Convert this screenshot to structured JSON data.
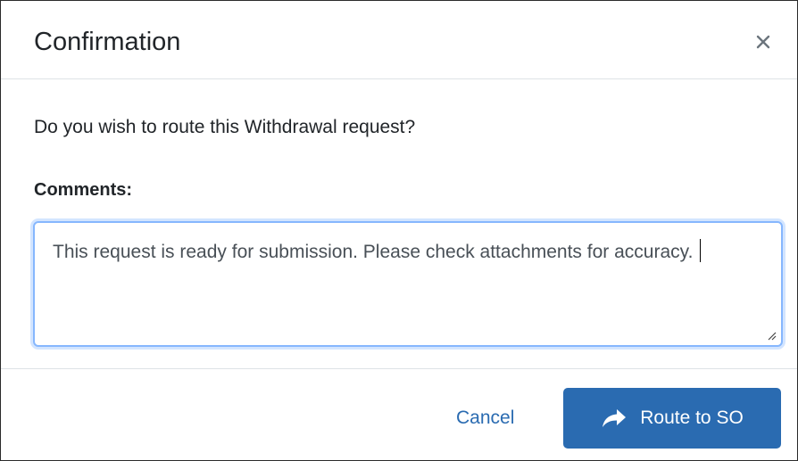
{
  "dialog": {
    "title": "Confirmation",
    "close_icon": "close-icon"
  },
  "body": {
    "question": "Do you wish to route this Withdrawal request?",
    "comments_label": "Comments:",
    "comments_value": "This request is ready for submission. Please check attachments for accuracy."
  },
  "footer": {
    "cancel_label": "Cancel",
    "route_label": "Route to SO",
    "route_icon": "share-arrow-icon"
  },
  "colors": {
    "primary": "#2a6bb1",
    "focus_border": "#86b7fe",
    "divider": "#dee2e6"
  }
}
